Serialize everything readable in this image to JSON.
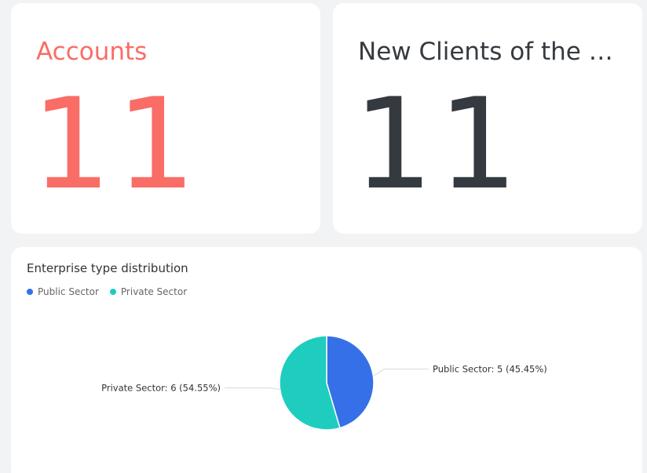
{
  "kpis": [
    {
      "title": "Accounts",
      "value": "11",
      "color": "#f96d66"
    },
    {
      "title": "New Clients of the month",
      "value": "11",
      "color": "#353a40"
    }
  ],
  "chart_data": {
    "type": "pie",
    "title": "Enterprise type distribution",
    "legend_position": "top-left",
    "slices": [
      {
        "name": "Public Sector",
        "value": 5,
        "percent": 45.45,
        "color": "#3570e8",
        "label": "Public Sector: 5 (45.45%)"
      },
      {
        "name": "Private Sector",
        "value": 6,
        "percent": 54.55,
        "color": "#1fcdbf",
        "label": "Private Sector: 6 (54.55%)"
      }
    ]
  }
}
